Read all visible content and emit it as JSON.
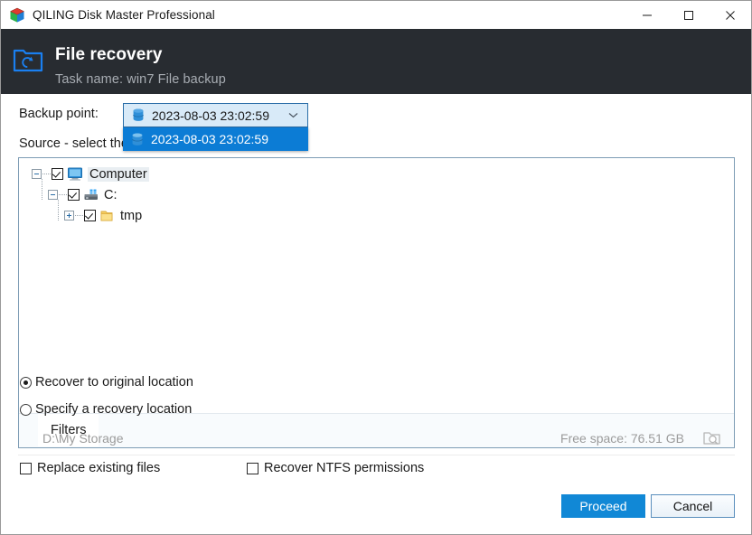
{
  "window": {
    "title": "QILING Disk Master Professional",
    "app_icon": "cube-icon",
    "controls": {
      "minimize": "minimize-icon",
      "maximize": "maximize-icon",
      "close": "close-icon"
    }
  },
  "header": {
    "icon": "folder-recovery-icon",
    "title": "File recovery",
    "subtitle": "Task name: win7 File backup"
  },
  "backup_point": {
    "label": "Backup point:",
    "selected": "2023-08-03 23:02:59",
    "icon": "database-icon",
    "arrow": "chevron-down-icon",
    "open": true,
    "options": [
      {
        "label": "2023-08-03 23:02:59",
        "icon": "database-icon",
        "highlighted": true
      }
    ]
  },
  "source": {
    "label": "Source - select the files you want to restore",
    "tree": [
      {
        "level": 1,
        "expander": "minus",
        "checked": true,
        "icon": "computer-icon",
        "label": "Computer",
        "selected": true
      },
      {
        "level": 2,
        "expander": "minus",
        "checked": true,
        "icon": "drive-icon",
        "label": "C:",
        "selected": false
      },
      {
        "level": 3,
        "expander": "plus",
        "checked": true,
        "icon": "folder-icon",
        "label": "tmp",
        "selected": false
      }
    ],
    "filters_tab": "Filters"
  },
  "destination": {
    "radio_original": "Recover to original location",
    "radio_specify": "Specify a recovery location",
    "selected": "original",
    "path": "D:\\My Storage",
    "free_space": "Free space: 76.51 GB",
    "browse_icon": "browse-folder-icon"
  },
  "options": {
    "replace_existing": {
      "label": "Replace existing files",
      "checked": false
    },
    "recover_ntfs": {
      "label": "Recover NTFS permissions",
      "checked": false
    }
  },
  "footer": {
    "proceed": "Proceed",
    "cancel": "Cancel"
  },
  "colors": {
    "header_bg": "#282c31",
    "accent": "#1188d6",
    "dropdown_highlight": "#0c7cd5",
    "combo_bg": "#d8eaf8",
    "panel_border": "#7d9cb5"
  }
}
